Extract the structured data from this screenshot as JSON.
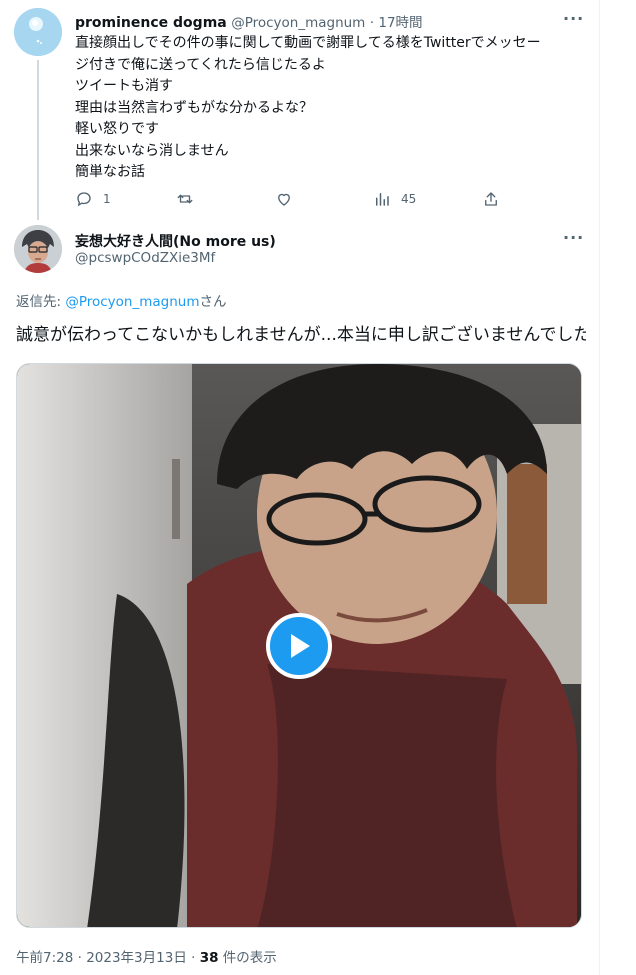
{
  "colors": {
    "accent": "#1d9bf0",
    "muted": "#536471",
    "text": "#0f1419"
  },
  "parent_tweet": {
    "name": "prominence dogma",
    "handle": "@Procyon_magnum",
    "time": "· 17時間",
    "more": "···",
    "lines": [
      "直接顔出しでその件の事に関して動画で謝罪してる様をTwitterでメッセー",
      "ジ付きで俺に送ってくれたら信じたるよ",
      "ツイートも消す",
      "理由は当然言わずもがな分かるよな？",
      "軽い怒りです",
      "出来ないなら消しません",
      "簡単なお話"
    ],
    "actions": {
      "reply_count": "1",
      "retweet_count": "",
      "like_count": "",
      "views_count": "45"
    }
  },
  "reply_tweet": {
    "name": "妄想大好き人間(No more us)",
    "handle": "@pcswpCOdZXie3Mf",
    "more": "···",
    "reply_prefix": "返信先: ",
    "reply_mention": "@Procyon_magnum",
    "reply_suffix": "さん",
    "text": "誠意が伝わってこないかもしれませんが...本当に申し訳ございませんでした",
    "video": {
      "play_icon": "play-icon"
    },
    "meta_time": "午前7:28 · 2023年3月13日 · ",
    "meta_views_count": "38",
    "meta_views_label": " 件の表示"
  }
}
